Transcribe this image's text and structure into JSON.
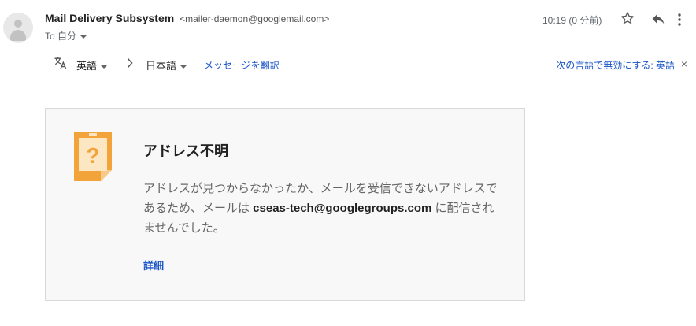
{
  "header": {
    "sender_name": "Mail Delivery Subsystem",
    "sender_email": "<mailer-daemon@googlemail.com>",
    "to_label": "To 自分",
    "time": "10:19 (0 分前)"
  },
  "translate_bar": {
    "source_lang": "英語",
    "target_lang": "日本語",
    "translate_link": "メッセージを翻訳",
    "disable_link": "次の言語で無効にする: 英語",
    "close": "×"
  },
  "card": {
    "title": "アドレス不明",
    "body_before": "アドレスが見つからなかったか、メールを受信できないアドレスであるため、メールは ",
    "body_email": "cseas-tech@googlegroups.com",
    "body_after": " に配信されませんでした。",
    "details_link": "詳細"
  },
  "icons": {
    "avatar": "avatar-icon",
    "star": "star-icon",
    "reply": "reply-icon",
    "more": "more-vert-icon",
    "translate": "translate-icon",
    "card": "question-note-icon"
  },
  "colors": {
    "link": "#1a55c8",
    "note_orange": "#f2a43a",
    "card_background": "#f8f8f8"
  }
}
